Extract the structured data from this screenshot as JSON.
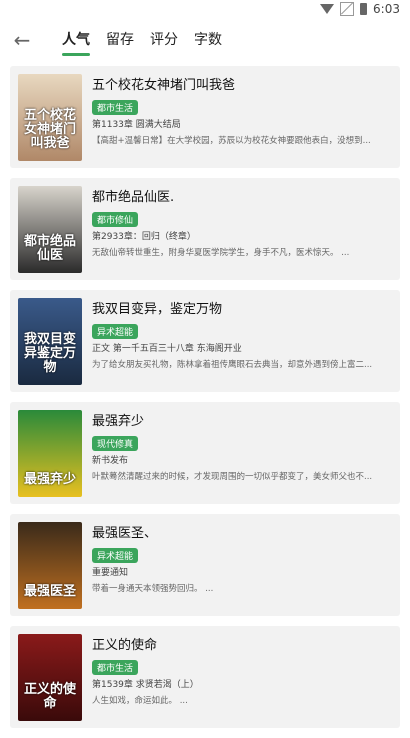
{
  "status": {
    "time": "6:03",
    "wifi_icon": "wifi-icon",
    "signal_icon": "no-signal-icon",
    "battery_icon": "battery-icon"
  },
  "header": {
    "back_icon": "arrow-left-icon",
    "tabs": [
      "人气",
      "留存",
      "评分",
      "字数"
    ],
    "active_tab": 0,
    "accent_color": "#3ba55c"
  },
  "books": [
    {
      "title": "五个校花女神堵门叫我爸",
      "tag": "都市生活",
      "chapter": "第1133章 圆满大结局",
      "desc": "【高甜+温馨日常】在大学校园，苏辰以为校花女神要跟他表白，没想到...",
      "cover_text": "五个校花女神堵门叫我爸",
      "cover_colors": [
        "#e8d8c0",
        "#b08868"
      ]
    },
    {
      "title": "都市绝品仙医.",
      "tag": "都市修仙",
      "chapter": "第2933章：回归（终章）",
      "desc": "无敌仙帝转世重生，附身华夏医学院学生，身手不凡，医术惊天。 ...",
      "cover_text": "都市绝品仙医",
      "cover_colors": [
        "#d8d4cc",
        "#2a2a2a"
      ]
    },
    {
      "title": "我双目变异，鉴定万物",
      "tag": "异术超能",
      "chapter": "正文 第一千五百三十八章 东海阁开业",
      "desc": "为了给女朋友买礼物，陈林拿着祖传鹰眼石去典当，却意外遇到傍上富二...",
      "cover_text": "我双目变异鉴定万物",
      "cover_colors": [
        "#3a5a8a",
        "#1a2a40"
      ]
    },
    {
      "title": "最强弃少",
      "tag": "现代修真",
      "chapter": "新书发布",
      "desc": "叶默蓦然清醒过来的时候，才发现周围的一切似乎都变了，美女师父也不...",
      "cover_text": "最强弃少",
      "cover_colors": [
        "#2a8a3a",
        "#e8c020"
      ]
    },
    {
      "title": "最强医圣、",
      "tag": "异术超能",
      "chapter": "重要通知",
      "desc": "带着一身通天本领强势回归。 ...",
      "cover_text": "最强医圣",
      "cover_colors": [
        "#3a2a1a",
        "#c07020"
      ]
    },
    {
      "title": "正义的使命",
      "tag": "都市生活",
      "chapter": "第1539章 求贤若渴（上）",
      "desc": "人生如戏，命运如此。 ...",
      "cover_text": "正义的使命",
      "cover_colors": [
        "#8a1a1a",
        "#3a0a0a"
      ]
    }
  ]
}
